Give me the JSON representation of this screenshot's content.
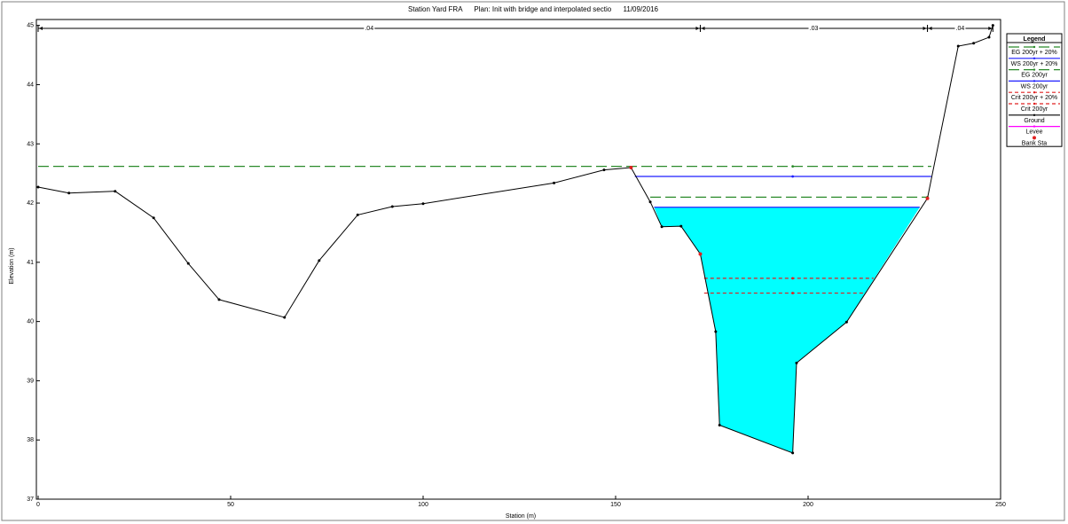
{
  "chart_data": {
    "type": "line",
    "title": "Station Yard FRA      Plan: Init with bridge and interpolated sectio      11/09/2016",
    "xlabel": "Station (m)",
    "ylabel": "Elevation (m)",
    "xlim": [
      0,
      250
    ],
    "ylim": [
      37,
      45.1
    ],
    "x_ticks": [
      0,
      50,
      100,
      150,
      200,
      250
    ],
    "y_ticks": [
      37,
      38,
      39,
      40,
      41,
      42,
      43,
      44,
      45
    ],
    "mannings": [
      {
        "label": ".04",
        "from": 0,
        "to": 172
      },
      {
        "label": ".03",
        "from": 172,
        "to": 231
      },
      {
        "label": ".04",
        "from": 231,
        "to": 248
      }
    ],
    "ground": {
      "name": "Ground",
      "color": "#000000",
      "points": [
        [
          0,
          42.27
        ],
        [
          8,
          42.17
        ],
        [
          20,
          42.2
        ],
        [
          30,
          41.75
        ],
        [
          39,
          40.98
        ],
        [
          47,
          40.37
        ],
        [
          64,
          40.07
        ],
        [
          73,
          41.03
        ],
        [
          83,
          41.8
        ],
        [
          92,
          41.94
        ],
        [
          100,
          41.99
        ],
        [
          134,
          42.34
        ],
        [
          147,
          42.56
        ],
        [
          154,
          42.6
        ],
        [
          159,
          42.02
        ],
        [
          162,
          41.6
        ],
        [
          167,
          41.61
        ],
        [
          172,
          41.14
        ],
        [
          176,
          39.83
        ],
        [
          177,
          38.25
        ],
        [
          196,
          37.78
        ],
        [
          197,
          39.3
        ],
        [
          210,
          39.99
        ],
        [
          231,
          42.08
        ],
        [
          239,
          44.65
        ],
        [
          243,
          44.7
        ],
        [
          247,
          44.8
        ],
        [
          248,
          45
        ]
      ]
    },
    "water_surface_fill": {
      "color": "#00ffff",
      "points": [
        [
          160,
          41.93
        ],
        [
          229,
          41.93
        ],
        [
          210,
          39.99
        ],
        [
          197,
          39.3
        ],
        [
          196,
          37.78
        ],
        [
          177,
          38.25
        ],
        [
          176,
          39.83
        ],
        [
          172,
          41.14
        ],
        [
          167,
          41.61
        ],
        [
          162,
          41.6
        ]
      ]
    },
    "series": [
      {
        "name": "EG 200yr + 20%",
        "color": "#2a8a2a",
        "style": "longdash",
        "y": 42.62,
        "x": [
          0,
          232
        ],
        "marker_x": 196
      },
      {
        "name": "WS 200yr + 20%",
        "color": "#1f1fff",
        "style": "solid",
        "y": 42.45,
        "x": [
          155,
          232
        ],
        "marker_x": 196
      },
      {
        "name": "EG 200yr",
        "color": "#2a8a2a",
        "style": "longdash",
        "y": 42.1,
        "x": [
          159,
          231
        ],
        "marker_x": 231
      },
      {
        "name": "WS 200yr",
        "color": "#1f1fff",
        "style": "solid",
        "y": 41.93,
        "x": [
          160,
          229
        ],
        "marker_x": null
      },
      {
        "name": "Crit 200yr + 20%",
        "color": "#e02020",
        "style": "dashed",
        "y": 40.73,
        "x": [
          173,
          217
        ],
        "marker_x": 196
      },
      {
        "name": "Crit 200yr",
        "color": "#e02020",
        "style": "dashed",
        "y": 40.48,
        "x": [
          173,
          215
        ],
        "marker_x": 196
      }
    ],
    "bank_stations": [
      [
        154,
        42.6
      ],
      [
        172,
        41.14
      ],
      [
        231,
        42.08
      ]
    ],
    "legend": {
      "title": "Legend",
      "placement": "top-right",
      "entries": [
        {
          "label": "EG 200yr + 20%",
          "color": "#2a8a2a",
          "style": "longdash"
        },
        {
          "label": "WS 200yr + 20%",
          "color": "#1f1fff",
          "style": "solid"
        },
        {
          "label": "EG 200yr",
          "color": "#2a8a2a",
          "style": "longdash"
        },
        {
          "label": "WS 200yr",
          "color": "#1f1fff",
          "style": "solid"
        },
        {
          "label": "Crit 200yr + 20%",
          "color": "#e02020",
          "style": "dashed"
        },
        {
          "label": "Crit 200yr",
          "color": "#e02020",
          "style": "dashed"
        },
        {
          "label": "Ground",
          "color": "#000000",
          "style": "solid"
        },
        {
          "label": "Levee",
          "color": "#ff00ff",
          "style": "solid"
        },
        {
          "label": "Bank Sta",
          "color": "#e02020",
          "style": "point"
        }
      ]
    },
    "grid": false
  }
}
